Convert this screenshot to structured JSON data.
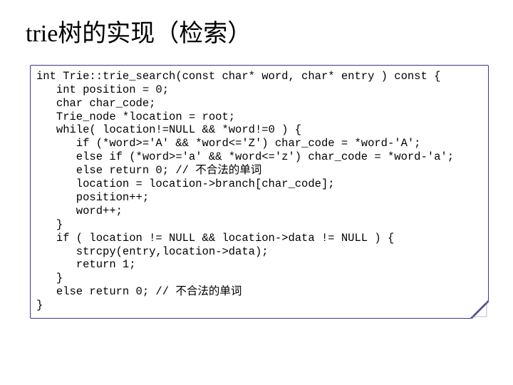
{
  "title_lat": "trie",
  "title_cjk": "树的实现（检索）",
  "code": {
    "l00": "int Trie::trie_search(const char* word, char* entry ) const {",
    "l01": "   int position = 0;",
    "l02": "   char char_code;",
    "l03": "   Trie_node *location = root;",
    "l04": "   while( location!=NULL && *word!=0 ) {",
    "l05": "      if (*word>='A' && *word<='Z') char_code = *word-'A';",
    "l06": "      else if (*word>='a' && *word<='z') char_code = *word-'a';",
    "l07": "      else return 0; // 不合法的单词",
    "l08": "      location = location->branch[char_code];",
    "l09": "      position++;",
    "l10": "      word++;",
    "l11": "   }",
    "l12": "   if ( location != NULL && location->data != NULL ) {",
    "l13": "      strcpy(entry,location->data);",
    "l14": "      return 1;",
    "l15": "   }",
    "l16": "   else return 0; // 不合法的单词",
    "l17": "}"
  }
}
